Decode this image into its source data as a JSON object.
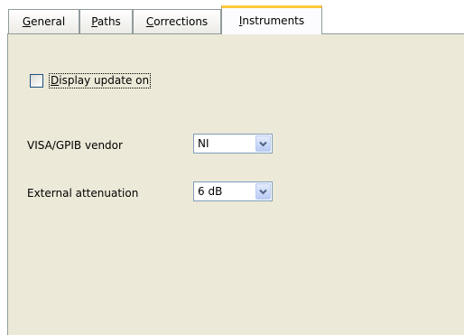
{
  "tabs": [
    {
      "access_key": "G",
      "rest": "eneral",
      "active": false
    },
    {
      "access_key": "P",
      "rest": "aths",
      "active": false
    },
    {
      "access_key": "C",
      "rest": "orrections",
      "active": false
    },
    {
      "access_key": "I",
      "rest": "nstruments",
      "active": true
    }
  ],
  "display_update": {
    "access_key": "D",
    "rest": "isplay update on",
    "checked": false
  },
  "visa_vendor": {
    "label": "VISA/GPIB vendor",
    "value": "NI"
  },
  "external_attenuation": {
    "label": "External attenuation",
    "value": "6 dB"
  },
  "icons": {
    "dropdown": "chevron-down-icon"
  },
  "colors": {
    "panel": "#ece9d8",
    "tab_border": "#919b9c",
    "active_tab_highlight": "#ffc83c",
    "control_border": "#7f9db9",
    "checkbox_border": "#1c5180",
    "dropdown_button": "#c1d3fb",
    "chevron": "#4d6185"
  }
}
